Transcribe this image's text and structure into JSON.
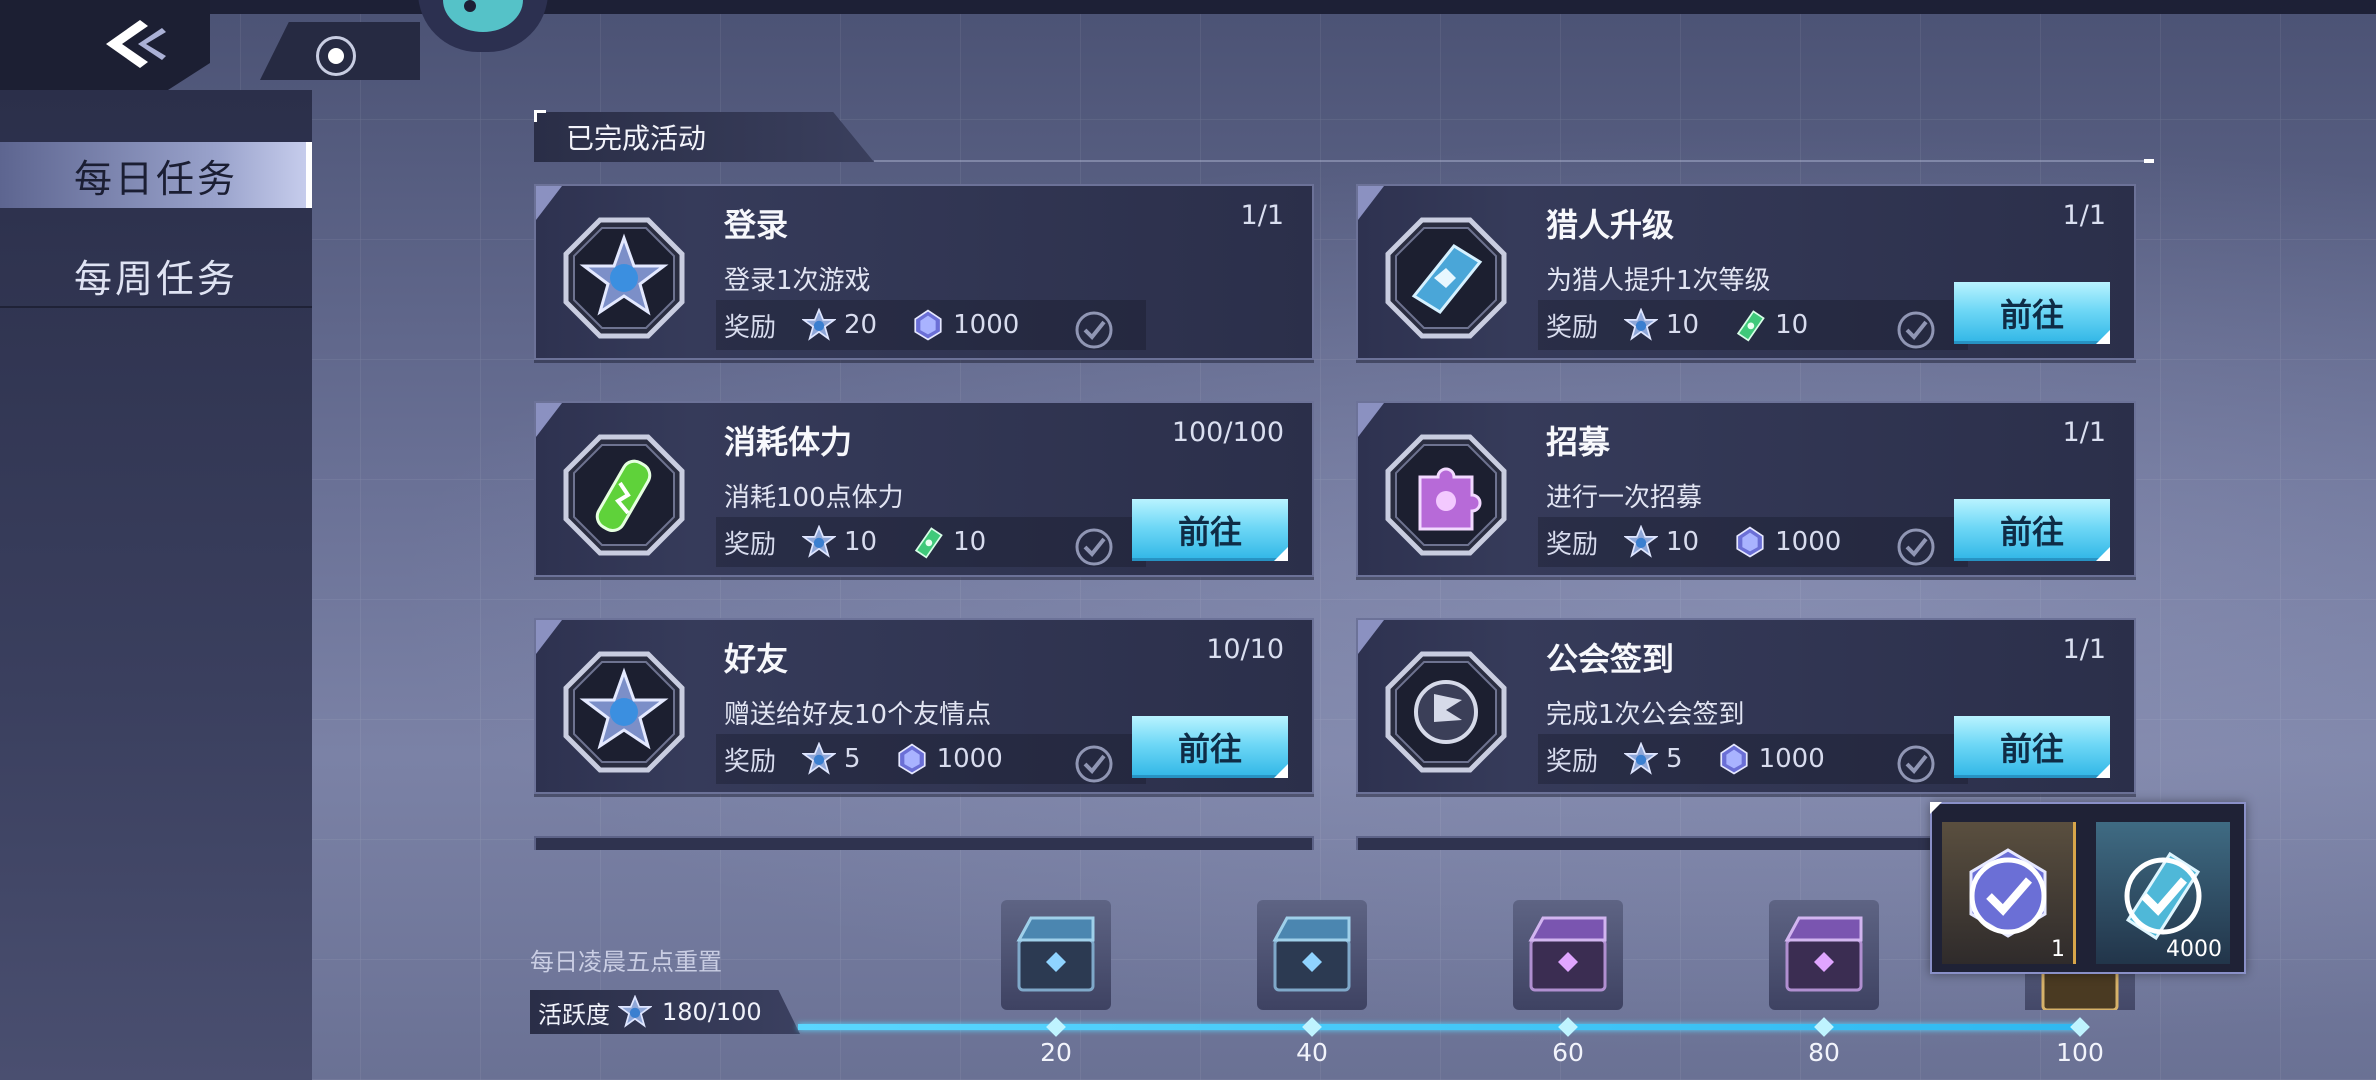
{
  "sidebar": {
    "items": [
      {
        "label": "每日任务",
        "active": true
      },
      {
        "label": "每周任务",
        "active": false
      }
    ]
  },
  "section": {
    "title": "已完成活动"
  },
  "common": {
    "reward_label": "奖励",
    "go_label": "前往"
  },
  "tasks": [
    {
      "title": "登录",
      "progress": "1/1",
      "desc": "登录1次游戏",
      "icon": "star-badge-icon",
      "rewards": [
        {
          "icon": "activity-point-icon",
          "amount": "20"
        },
        {
          "icon": "crystal-icon",
          "amount": "1000"
        }
      ],
      "has_go_button": false
    },
    {
      "title": "猎人升级",
      "progress": "1/1",
      "desc": "为猎人提升1次等级",
      "icon": "blue-book-icon",
      "rewards": [
        {
          "icon": "activity-point-icon",
          "amount": "10"
        },
        {
          "icon": "green-ticket-icon",
          "amount": "10"
        }
      ],
      "has_go_button": true
    },
    {
      "title": "消耗体力",
      "progress": "100/100",
      "desc": "消耗100点体力",
      "icon": "stamina-potion-icon",
      "rewards": [
        {
          "icon": "activity-point-icon",
          "amount": "10"
        },
        {
          "icon": "green-ticket-icon",
          "amount": "10"
        }
      ],
      "has_go_button": true
    },
    {
      "title": "招募",
      "progress": "1/1",
      "desc": "进行一次招募",
      "icon": "recruit-puzzle-icon",
      "rewards": [
        {
          "icon": "activity-point-icon",
          "amount": "10"
        },
        {
          "icon": "crystal-icon",
          "amount": "1000"
        }
      ],
      "has_go_button": true
    },
    {
      "title": "好友",
      "progress": "10/10",
      "desc": "赠送给好友10个友情点",
      "icon": "star-badge-icon",
      "rewards": [
        {
          "icon": "activity-point-icon",
          "amount": "5"
        },
        {
          "icon": "crystal-icon",
          "amount": "1000"
        }
      ],
      "has_go_button": true
    },
    {
      "title": "公会签到",
      "progress": "1/1",
      "desc": "完成1次公会签到",
      "icon": "guild-flag-icon",
      "rewards": [
        {
          "icon": "activity-point-icon",
          "amount": "5"
        },
        {
          "icon": "crystal-icon",
          "amount": "1000"
        }
      ],
      "has_go_button": true
    }
  ],
  "bottom": {
    "reset_text": "每日凌晨五点重置",
    "activity_label": "活跃度",
    "activity_value": "180/100",
    "progress_fraction": 1.0,
    "milestones": [
      {
        "value": "20",
        "chest": "blue-chest-icon"
      },
      {
        "value": "40",
        "chest": "blue-chest-icon"
      },
      {
        "value": "60",
        "chest": "purple-chest-icon"
      },
      {
        "value": "80",
        "chest": "purple-chest-icon"
      },
      {
        "value": "100",
        "chest": "gold-chest-icon"
      }
    ]
  },
  "popup": {
    "items": [
      {
        "icon": "claimed-crystal-icon",
        "count": "1"
      },
      {
        "icon": "claimed-ticket-icon",
        "count": "4000"
      }
    ]
  },
  "colors": {
    "accent": "#6fd8f6",
    "card_bg": "#2e3250",
    "sidebar_active": "#9aa3cc"
  }
}
